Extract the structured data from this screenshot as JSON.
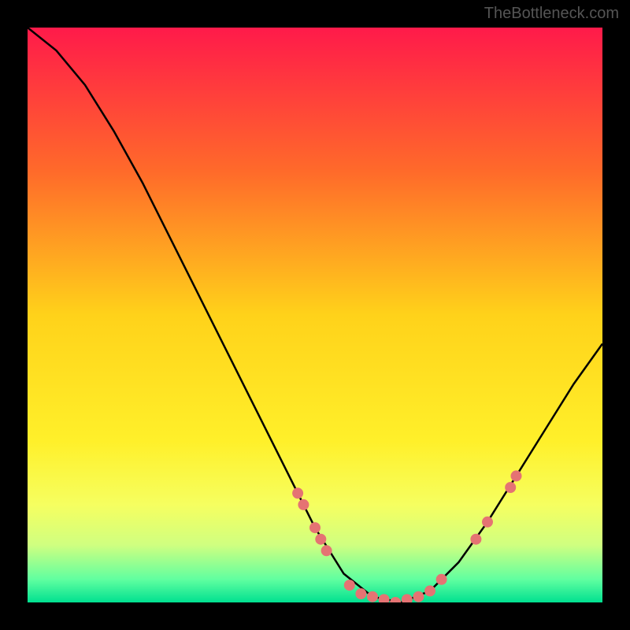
{
  "watermark": "TheBottleneck.com",
  "chart_data": {
    "type": "line",
    "title": "",
    "xlabel": "",
    "ylabel": "",
    "xlim": [
      0,
      100
    ],
    "ylim": [
      0,
      100
    ],
    "curve": [
      {
        "x": 0,
        "y": 100
      },
      {
        "x": 5,
        "y": 96
      },
      {
        "x": 10,
        "y": 90
      },
      {
        "x": 15,
        "y": 82
      },
      {
        "x": 20,
        "y": 73
      },
      {
        "x": 25,
        "y": 63
      },
      {
        "x": 30,
        "y": 53
      },
      {
        "x": 35,
        "y": 43
      },
      {
        "x": 40,
        "y": 33
      },
      {
        "x": 45,
        "y": 23
      },
      {
        "x": 50,
        "y": 13
      },
      {
        "x": 55,
        "y": 5
      },
      {
        "x": 60,
        "y": 1
      },
      {
        "x": 65,
        "y": 0
      },
      {
        "x": 70,
        "y": 2
      },
      {
        "x": 75,
        "y": 7
      },
      {
        "x": 80,
        "y": 14
      },
      {
        "x": 85,
        "y": 22
      },
      {
        "x": 90,
        "y": 30
      },
      {
        "x": 95,
        "y": 38
      },
      {
        "x": 100,
        "y": 45
      }
    ],
    "highlight_points": [
      {
        "x": 47,
        "y": 19
      },
      {
        "x": 48,
        "y": 17
      },
      {
        "x": 50,
        "y": 13
      },
      {
        "x": 51,
        "y": 11
      },
      {
        "x": 52,
        "y": 9
      },
      {
        "x": 56,
        "y": 3
      },
      {
        "x": 58,
        "y": 1.5
      },
      {
        "x": 60,
        "y": 1
      },
      {
        "x": 62,
        "y": 0.5
      },
      {
        "x": 64,
        "y": 0
      },
      {
        "x": 66,
        "y": 0.5
      },
      {
        "x": 68,
        "y": 1
      },
      {
        "x": 70,
        "y": 2
      },
      {
        "x": 72,
        "y": 4
      },
      {
        "x": 78,
        "y": 11
      },
      {
        "x": 80,
        "y": 14
      },
      {
        "x": 84,
        "y": 20
      },
      {
        "x": 85,
        "y": 22
      }
    ],
    "gradient_stops": [
      {
        "offset": 0,
        "color": "#ff1a4a"
      },
      {
        "offset": 0.25,
        "color": "#ff6a2a"
      },
      {
        "offset": 0.5,
        "color": "#ffd21a"
      },
      {
        "offset": 0.72,
        "color": "#fff02a"
      },
      {
        "offset": 0.83,
        "color": "#f6ff60"
      },
      {
        "offset": 0.9,
        "color": "#d0ff80"
      },
      {
        "offset": 0.96,
        "color": "#60ffa0"
      },
      {
        "offset": 1.0,
        "color": "#00e090"
      }
    ],
    "point_color": "#e57373",
    "curve_color": "#000000"
  }
}
